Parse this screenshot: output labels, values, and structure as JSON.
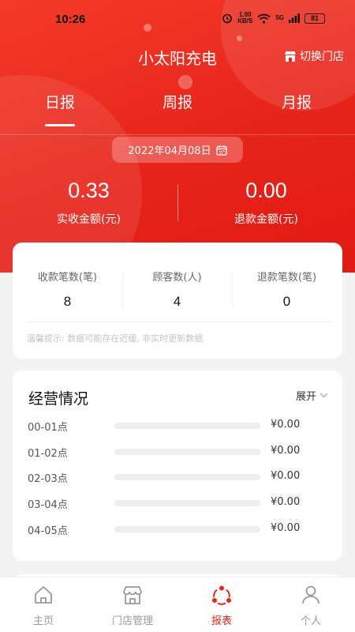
{
  "status_bar": {
    "time": "10:26",
    "speed_value": "1.00",
    "speed_unit": "KB/S",
    "signal": "5G",
    "battery": "81"
  },
  "header": {
    "title": "小太阳充电",
    "switch_store_label": "切换门店"
  },
  "tabs": [
    {
      "label": "日报",
      "active": true
    },
    {
      "label": "周报",
      "active": false
    },
    {
      "label": "月报",
      "active": false
    }
  ],
  "date": "2022年04月08日",
  "amounts": {
    "received_value": "0.33",
    "received_label": "实收金额(元)",
    "refund_value": "0.00",
    "refund_label": "退款金额(元)"
  },
  "stats": [
    {
      "label": "收款笔数(笔)",
      "value": "8"
    },
    {
      "label": "顾客数(人)",
      "value": "4"
    },
    {
      "label": "退款笔数(笔)",
      "value": "0"
    }
  ],
  "tip": "温馨提示: 数据可能存在迟缓, 非实时更新数据",
  "operations": {
    "title": "经营情况",
    "expand_label": "展开",
    "rows": [
      {
        "time": "00-01点",
        "amount": "¥0.00",
        "share": 0
      },
      {
        "time": "01-02点",
        "amount": "¥0.00",
        "share": 0
      },
      {
        "time": "02-03点",
        "amount": "¥0.00",
        "share": 0
      },
      {
        "time": "03-04点",
        "amount": "¥0.00",
        "share": 0
      },
      {
        "time": "04-05点",
        "amount": "¥0.00",
        "share": 0
      }
    ]
  },
  "bottom_nav": [
    {
      "label": "主页",
      "icon": "home-icon",
      "active": false
    },
    {
      "label": "门店管理",
      "icon": "store-icon",
      "active": false
    },
    {
      "label": "报表",
      "icon": "report-icon",
      "active": true
    },
    {
      "label": "个人",
      "icon": "person-icon",
      "active": false
    }
  ],
  "colors": {
    "brand_red": "#e5261c",
    "inactive_gray": "#999999"
  }
}
